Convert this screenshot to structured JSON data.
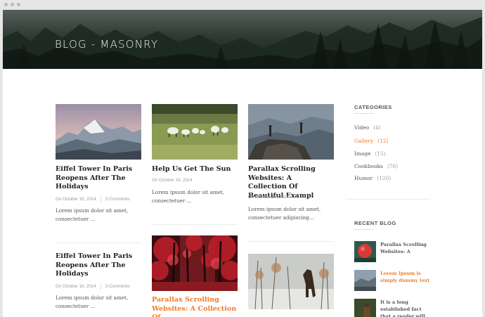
{
  "header": {
    "title": "BLOG - MASONRY"
  },
  "posts": [
    {
      "title": "Eiffel Tower In Paris Reopens After The Holidays",
      "date": "On October 16, 2014",
      "comments": "3 Comments",
      "excerpt": "Lorem ipsum dolor sit amet, consectetuer ..."
    },
    {
      "title": "Help Us Get The Sun",
      "date": "On October 16, 2014",
      "excerpt": "Lorem ipsum dolor sit amet, consectetuer ..."
    },
    {
      "title": "Parallax Scrolling Websites: A Collection  Of Beautiful Exampl",
      "date": "On October 16, 2014",
      "excerpt": "Lorem ipsum dolor sit amet, consectetuer adipiscing..."
    },
    {
      "title": "Eiffel Tower In Paris Reopens After The Holidays",
      "date": "On October 16, 2014",
      "comments": "3 Comments",
      "excerpt": "Lorem ipsum dolor sit amet, consectetuer ..."
    },
    {
      "title": "Parallax Scrolling Websites: A Collection  Of"
    }
  ],
  "sidebar": {
    "categories_heading": "CATEGORIES",
    "categories": [
      {
        "name": "Video",
        "count": "(4)"
      },
      {
        "name": "Gallery",
        "count": "(12)"
      },
      {
        "name": "Image",
        "count": "(15)"
      },
      {
        "name": "Cookbooks",
        "count": "(76)"
      },
      {
        "name": "Humor",
        "count": "(120)"
      }
    ],
    "recent_heading": "RECENT BLOG",
    "recent": [
      {
        "title": "Parallax Scrolling Websites: A"
      },
      {
        "title": "Lorem Ipsum is simply dummy text"
      },
      {
        "title": "It is a long established fact that a reader will"
      }
    ]
  },
  "colors": {
    "accent": "#ef7b2d",
    "text": "#222222",
    "muted": "#9a9a9a"
  }
}
